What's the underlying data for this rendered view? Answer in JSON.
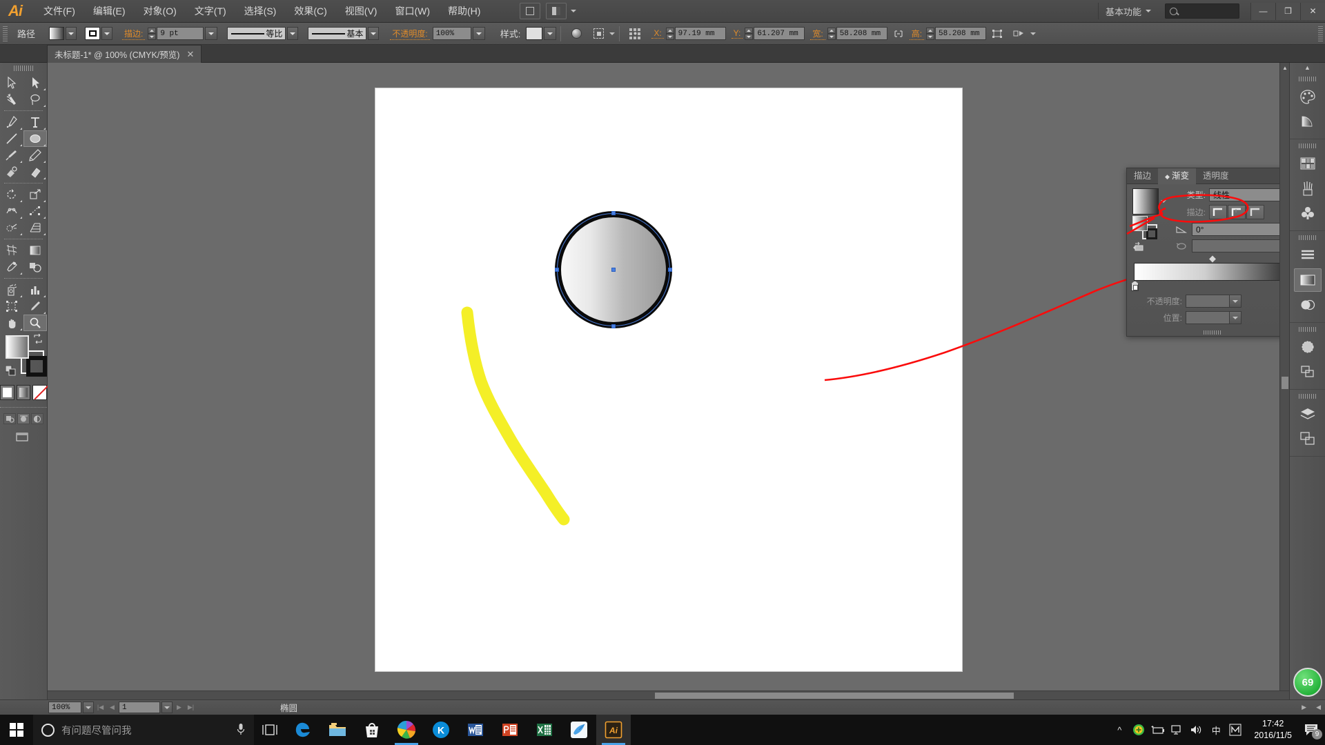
{
  "app": {
    "name": "Adobe Illustrator",
    "logo_text": "Ai",
    "workspace": "基本功能"
  },
  "menu": {
    "items": [
      {
        "label": "文件(F)"
      },
      {
        "label": "编辑(E)"
      },
      {
        "label": "对象(O)"
      },
      {
        "label": "文字(T)"
      },
      {
        "label": "选择(S)"
      },
      {
        "label": "效果(C)"
      },
      {
        "label": "视图(V)"
      },
      {
        "label": "窗口(W)"
      },
      {
        "label": "帮助(H)"
      }
    ],
    "window_buttons": {
      "minimize": "—",
      "restore": "❐",
      "close": "✕"
    }
  },
  "control_bar": {
    "object_label": "路径",
    "stroke_label": "描边:",
    "stroke_weight": "9 pt",
    "stroke_profile": "等比",
    "brush_definition": "基本",
    "opacity_label": "不透明度:",
    "opacity_value": "100%",
    "style_label": "样式:",
    "x_label": "X:",
    "x_value": "97.19 mm",
    "y_label": "Y:",
    "y_value": "61.207 mm",
    "w_label": "宽:",
    "w_value": "58.208 mm",
    "h_label": "高:",
    "h_value": "58.208 mm"
  },
  "document_tab": {
    "title": "未标题-1* @ 100% (CMYK/预览)",
    "close": "✕"
  },
  "tools": [
    {
      "name": "selection-tool",
      "sel": false
    },
    {
      "name": "direct-selection-tool",
      "sel": false
    },
    {
      "name": "magic-wand-tool",
      "sel": false
    },
    {
      "name": "lasso-tool",
      "sel": false
    },
    {
      "name": "pen-tool",
      "sel": false
    },
    {
      "name": "type-tool",
      "sel": false
    },
    {
      "name": "line-segment-tool",
      "sel": false
    },
    {
      "name": "ellipse-tool",
      "sel": true
    },
    {
      "name": "paintbrush-tool",
      "sel": false
    },
    {
      "name": "pencil-tool",
      "sel": false
    },
    {
      "name": "blob-brush-tool",
      "sel": false
    },
    {
      "name": "eraser-tool",
      "sel": false
    },
    {
      "name": "rotate-tool",
      "sel": false
    },
    {
      "name": "scale-tool",
      "sel": false
    },
    {
      "name": "width-tool",
      "sel": false
    },
    {
      "name": "free-transform-tool",
      "sel": false
    },
    {
      "name": "shape-builder-tool",
      "sel": false
    },
    {
      "name": "perspective-grid-tool",
      "sel": false
    },
    {
      "name": "mesh-tool",
      "sel": false
    },
    {
      "name": "gradient-tool",
      "sel": false
    },
    {
      "name": "eyedropper-tool",
      "sel": false
    },
    {
      "name": "blend-tool",
      "sel": false
    },
    {
      "name": "symbol-sprayer-tool",
      "sel": false
    },
    {
      "name": "column-graph-tool",
      "sel": false
    },
    {
      "name": "artboard-tool",
      "sel": false
    },
    {
      "name": "slice-tool",
      "sel": false
    },
    {
      "name": "hand-tool",
      "sel": false
    },
    {
      "name": "zoom-tool",
      "sel": true
    }
  ],
  "gradient_panel": {
    "tabs": [
      {
        "label": "描边",
        "active": false
      },
      {
        "label": "渐变",
        "active": true
      },
      {
        "label": "透明度",
        "active": false
      }
    ],
    "type_label": "类型:",
    "type_value": "线性",
    "stroke_label": "描边:",
    "angle_label": "角度",
    "angle_value": "0°",
    "aspect_value": "",
    "opacity_label": "不透明度:",
    "opacity_value": "",
    "location_label": "位置:",
    "location_value": "",
    "collapse_icon": "»",
    "menu_icon": "≡",
    "gradient_start": "#ffffff",
    "gradient_end": "#2c2c2c"
  },
  "right_dock": {
    "items": [
      {
        "name": "color-panel-icon"
      },
      {
        "name": "color-guide-panel-icon"
      },
      {
        "name": "swatches-panel-icon"
      },
      {
        "name": "brushes-panel-icon"
      },
      {
        "name": "symbols-panel-icon"
      },
      {
        "name": "stroke-panel-icon"
      },
      {
        "name": "gradient-panel-icon"
      },
      {
        "name": "transparency-panel-icon"
      },
      {
        "name": "appearance-panel-icon"
      },
      {
        "name": "graphic-styles-panel-icon"
      },
      {
        "name": "layers-panel-icon"
      },
      {
        "name": "artboards-panel-icon"
      }
    ]
  },
  "status_bar": {
    "zoom": "100%",
    "page": "1",
    "tool_status": "椭圆"
  },
  "canvas": {
    "objects": [
      {
        "name": "ellipse-with-gradient-fill",
        "type": "circle"
      },
      {
        "name": "yellow-brush-stroke",
        "type": "path",
        "color": "#f5f028"
      },
      {
        "name": "red-annotation-arrow",
        "type": "annotation",
        "color": "#ff0000"
      },
      {
        "name": "red-annotation-circle",
        "type": "annotation",
        "color": "#ff0000"
      }
    ]
  },
  "taskbar": {
    "cortana_placeholder": "有问题尽管问我",
    "apps": [
      {
        "name": "microsoft-edge",
        "label": "e"
      },
      {
        "name": "file-explorer",
        "label": ""
      },
      {
        "name": "microsoft-store",
        "label": ""
      },
      {
        "name": "photos",
        "label": ""
      },
      {
        "name": "kingsoft-app",
        "label": "K"
      },
      {
        "name": "microsoft-word",
        "label": "W"
      },
      {
        "name": "microsoft-powerpoint",
        "label": "P"
      },
      {
        "name": "microsoft-excel",
        "label": "X"
      },
      {
        "name": "bird-app",
        "label": ""
      },
      {
        "name": "adobe-illustrator",
        "label": "Ai"
      }
    ],
    "tray": {
      "ime_label": "中",
      "ime_mode": "M",
      "time": "17:42",
      "date": "2016/11/5",
      "notification_count": "9"
    }
  },
  "overlay": {
    "badge_value": "69"
  }
}
